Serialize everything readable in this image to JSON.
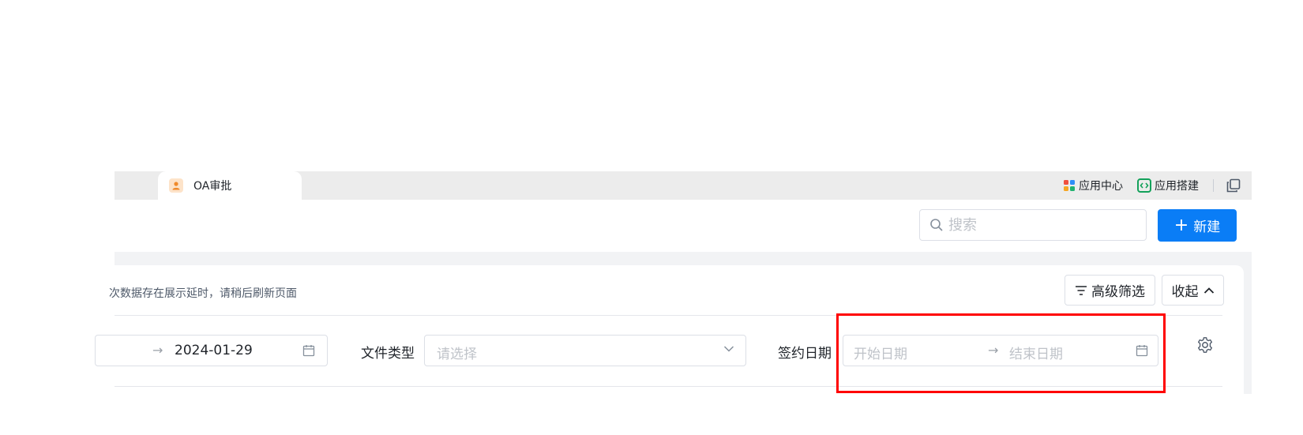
{
  "tabs": [
    {
      "label": "OA审批",
      "icon": "person-avatar-icon",
      "active": true
    }
  ],
  "top_links": {
    "app_center": {
      "label": "应用中心",
      "icon": "app-grid-icon"
    },
    "app_builder": {
      "label": "应用搭建",
      "icon": "code-icon"
    },
    "extra_icon": "window-icon"
  },
  "header": {
    "search_placeholder": "搜索",
    "new_button_label": "新建",
    "new_button_icon": "plus-icon"
  },
  "card": {
    "notice": "次数据存在展示延时，请稍后刷新页面",
    "advanced_filter_label": "高级筛选",
    "collapse_label": "收起"
  },
  "filters": {
    "date_range_1": {
      "end_value": "2024-01-29"
    },
    "file_type": {
      "label": "文件类型",
      "placeholder": "请选择"
    },
    "sign_date": {
      "label": "签约日期",
      "start_placeholder": "开始日期",
      "end_placeholder": "结束日期"
    }
  },
  "colors": {
    "primary": "#0a7df6",
    "highlight_box": "#ff0000",
    "tab_bar_bg": "#ececec"
  }
}
